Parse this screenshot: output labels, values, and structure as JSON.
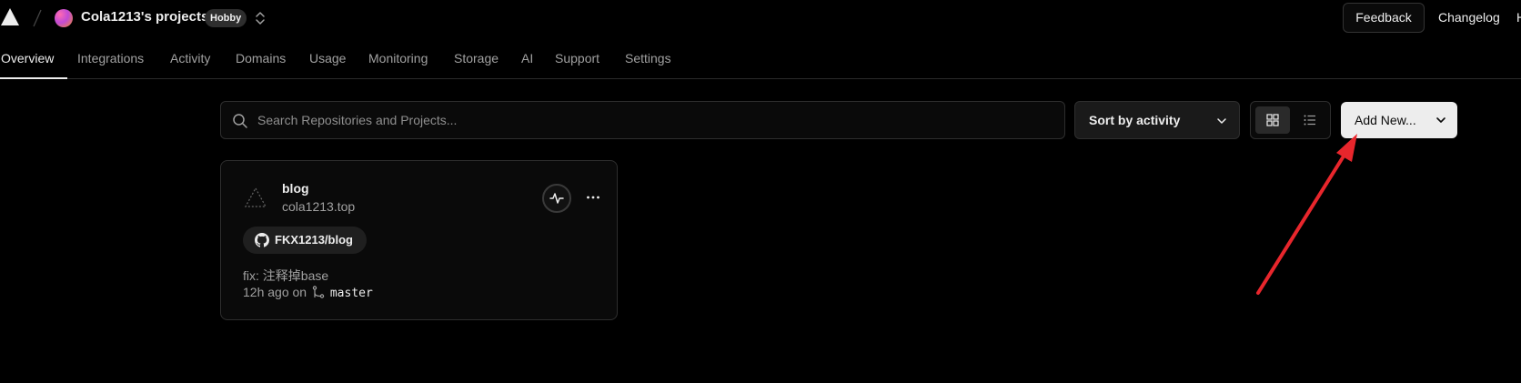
{
  "header": {
    "project_name": "Cola1213's projects",
    "plan_badge": "Hobby",
    "feedback_label": "Feedback",
    "changelog_label": "Changelog",
    "trailing_link_label": "H"
  },
  "tabs": [
    {
      "label": "Overview",
      "active": true
    },
    {
      "label": "Integrations",
      "active": false
    },
    {
      "label": "Activity",
      "active": false
    },
    {
      "label": "Domains",
      "active": false
    },
    {
      "label": "Usage",
      "active": false
    },
    {
      "label": "Monitoring",
      "active": false
    },
    {
      "label": "Storage",
      "active": false
    },
    {
      "label": "AI",
      "active": false
    },
    {
      "label": "Support",
      "active": false
    },
    {
      "label": "Settings",
      "active": false
    }
  ],
  "toolbar": {
    "search_placeholder": "Search Repositories and Projects...",
    "search_value": "",
    "sort_label": "Sort by activity",
    "view_mode": "grid",
    "add_new_label": "Add New..."
  },
  "projects": [
    {
      "name": "blog",
      "domain": "cola1213.top",
      "repo": "FKX1213/blog",
      "commit_message": "fix: 注释掉base",
      "commit_time": "12h ago on",
      "branch": "master"
    }
  ],
  "colors": {
    "background": "#000000",
    "text_primary": "#ededed",
    "text_secondary": "#a1a1a1",
    "border": "#2e2e2e",
    "add_new_button_bg": "#ededed",
    "annotation_arrow": "#e8262c"
  },
  "icons": {
    "logo": "vercel-triangle-icon",
    "switcher": "chevron-up-down-icon",
    "search": "search-icon",
    "sort": "chevron-down-icon",
    "grid_view": "grid-icon",
    "list_view": "list-icon",
    "add_new": "chevron-down-icon",
    "project": "dashed-triangle-icon",
    "activity": "pulse-icon",
    "more": "ellipsis-icon",
    "repo": "github-icon",
    "branch": "git-branch-icon"
  }
}
